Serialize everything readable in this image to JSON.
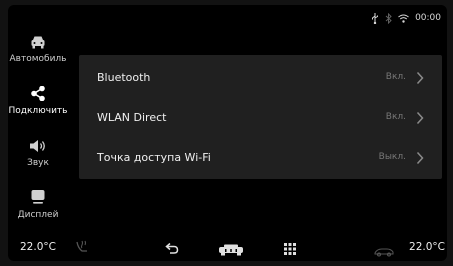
{
  "status": {
    "time": "00:00",
    "icons": [
      "usb-icon",
      "bluetooth-icon",
      "wifi-icon"
    ]
  },
  "sidebar": {
    "items": [
      {
        "label": "Автомобиль",
        "icon": "car-icon",
        "active": false
      },
      {
        "label": "Подключить",
        "icon": "share-icon",
        "active": true
      },
      {
        "label": "Звук",
        "icon": "speaker-icon",
        "active": false
      },
      {
        "label": "Дисплей",
        "icon": "display-icon",
        "active": false
      }
    ]
  },
  "connections": {
    "rows": [
      {
        "name": "Bluetooth",
        "value": "Вкл."
      },
      {
        "name": "WLAN Direct",
        "value": "Вкл."
      },
      {
        "name": "Точка доступа Wi-Fi",
        "value": "Выкл."
      }
    ]
  },
  "bottom_bar": {
    "left_temp": "22.0°C",
    "right_temp": "22.0°C",
    "icons": [
      "seat-heat-icon",
      "back-icon",
      "home-car-icon",
      "apps-grid-icon",
      "climate-fan-icon"
    ]
  },
  "colors": {
    "background": "#000000",
    "panel": "#202020",
    "text": "#f0f0f0",
    "muted": "#777777"
  }
}
